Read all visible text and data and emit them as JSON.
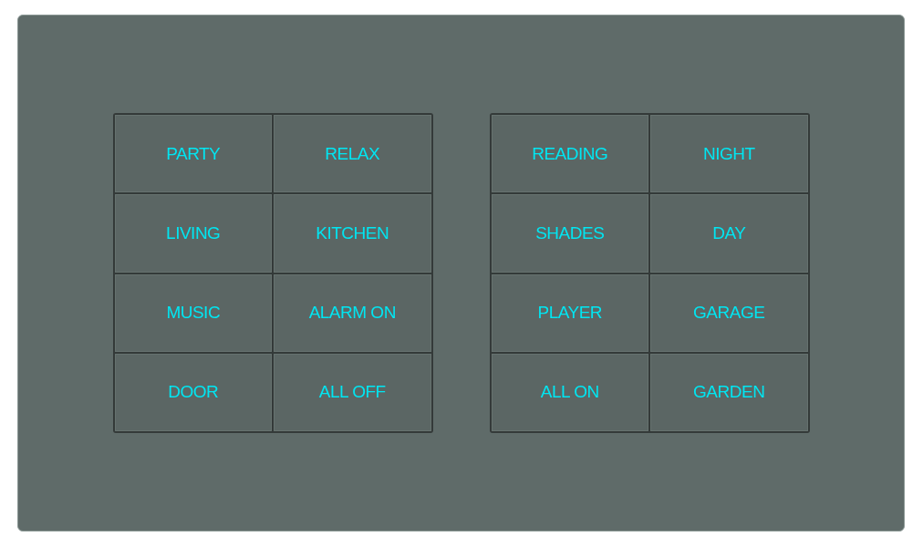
{
  "keypads": [
    {
      "buttons": [
        {
          "label": "PARTY"
        },
        {
          "label": "RELAX"
        },
        {
          "label": "LIVING"
        },
        {
          "label": "KITCHEN"
        },
        {
          "label": "MUSIC"
        },
        {
          "label": "ALARM ON"
        },
        {
          "label": "DOOR"
        },
        {
          "label": "ALL OFF"
        }
      ]
    },
    {
      "buttons": [
        {
          "label": "READING"
        },
        {
          "label": "NIGHT"
        },
        {
          "label": "SHADES"
        },
        {
          "label": "DAY"
        },
        {
          "label": "PLAYER"
        },
        {
          "label": "GARAGE"
        },
        {
          "label": "ALL ON"
        },
        {
          "label": "GARDEN"
        }
      ]
    }
  ]
}
